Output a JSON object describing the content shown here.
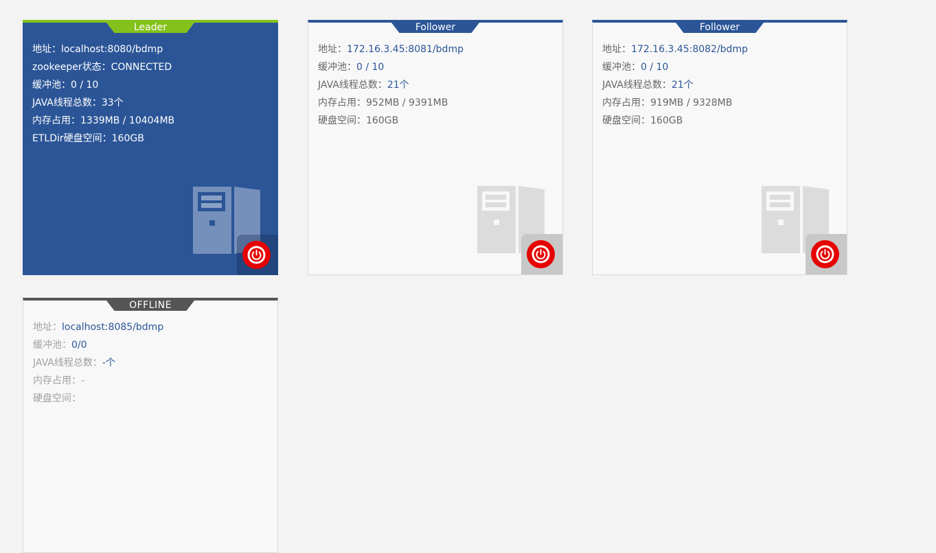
{
  "nodes": [
    {
      "role": "Leader",
      "info": [
        {
          "label": "地址：",
          "value": "localhost:8080/bdmp"
        },
        {
          "label": "zookeeper状态：",
          "value": "CONNECTED"
        },
        {
          "label": "缓冲池：",
          "value": "0 / 10"
        },
        {
          "label": "JAVA线程总数：",
          "value": "33个"
        },
        {
          "label": "内存占用：",
          "value": "1339MB / 10404MB"
        },
        {
          "label": "ETLDir硬盘空间：",
          "value": "160GB"
        }
      ]
    },
    {
      "role": "Follower",
      "info": [
        {
          "label": "地址：",
          "value": "172.16.3.45:8081/bdmp"
        },
        {
          "label": "缓冲池：",
          "value": "0 / 10"
        },
        {
          "label": "JAVA线程总数：",
          "value": "21个"
        },
        {
          "label": "内存占用：",
          "value": "952MB / 9391MB"
        },
        {
          "label": "硬盘空间：",
          "value": "160GB"
        }
      ]
    },
    {
      "role": "Follower",
      "info": [
        {
          "label": "地址：",
          "value": "172.16.3.45:8082/bdmp"
        },
        {
          "label": "缓冲池：",
          "value": "0 / 10"
        },
        {
          "label": "JAVA线程总数：",
          "value": "21个"
        },
        {
          "label": "内存占用：",
          "value": "919MB / 9328MB"
        },
        {
          "label": "硬盘空间：",
          "value": "160GB"
        }
      ]
    },
    {
      "role": "OFFLINE",
      "info": [
        {
          "label": "地址：",
          "value": "localhost:8085/bdmp"
        },
        {
          "label": "缓冲池：",
          "value": "0/0"
        },
        {
          "label": "JAVA线程总数：",
          "value": "-个"
        },
        {
          "label": "内存占用：",
          "value": "-"
        },
        {
          "label": "硬盘空间：",
          "value": ""
        }
      ]
    }
  ],
  "icons": {
    "server": "server-icon",
    "power": "power-icon"
  },
  "colors": {
    "leader_bg": "#2b5597",
    "leader_accent": "#84c21b",
    "follower_accent": "#2b5597",
    "offline_accent": "#555555",
    "power_button": "#e60000"
  }
}
